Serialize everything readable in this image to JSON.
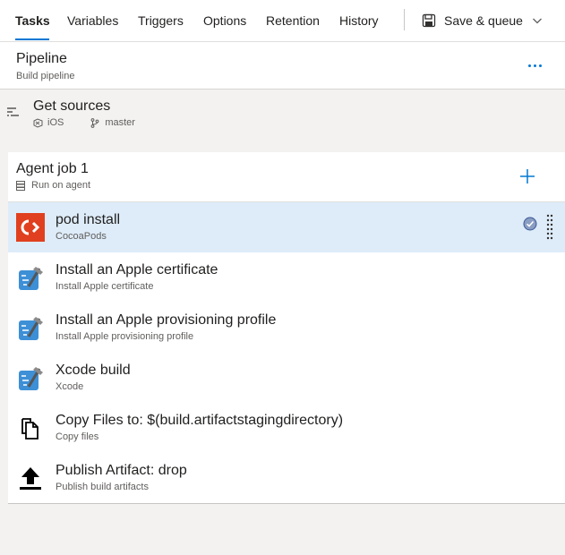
{
  "tabs": [
    {
      "label": "Tasks",
      "active": true
    },
    {
      "label": "Variables"
    },
    {
      "label": "Triggers"
    },
    {
      "label": "Options"
    },
    {
      "label": "Retention"
    },
    {
      "label": "History"
    }
  ],
  "save": {
    "label": "Save & queue"
  },
  "pipeline": {
    "title": "Pipeline",
    "subtitle": "Build pipeline"
  },
  "sources": {
    "title": "Get sources",
    "repo": "iOS",
    "branch": "master"
  },
  "job": {
    "title": "Agent job 1",
    "subtitle": "Run on agent"
  },
  "tasks": [
    {
      "name": "pod install",
      "desc": "CocoaPods",
      "icon": "cocoapods-icon",
      "selected": true
    },
    {
      "name": "Install an Apple certificate",
      "desc": "Install Apple certificate",
      "icon": "xcode-icon"
    },
    {
      "name": "Install an Apple provisioning profile",
      "desc": "Install Apple provisioning profile",
      "icon": "xcode-icon"
    },
    {
      "name": "Xcode build",
      "desc": "Xcode",
      "icon": "xcode-icon"
    },
    {
      "name": "Copy Files to: $(build.artifactstagingdirectory)",
      "desc": "Copy files",
      "icon": "copy-files-icon"
    },
    {
      "name": "Publish Artifact: drop",
      "desc": "Publish build artifacts",
      "icon": "publish-artifact-icon"
    }
  ],
  "colors": {
    "accent": "#0078d4",
    "selected_bg": "#deecf9",
    "cocoapods": "#e0401f"
  }
}
